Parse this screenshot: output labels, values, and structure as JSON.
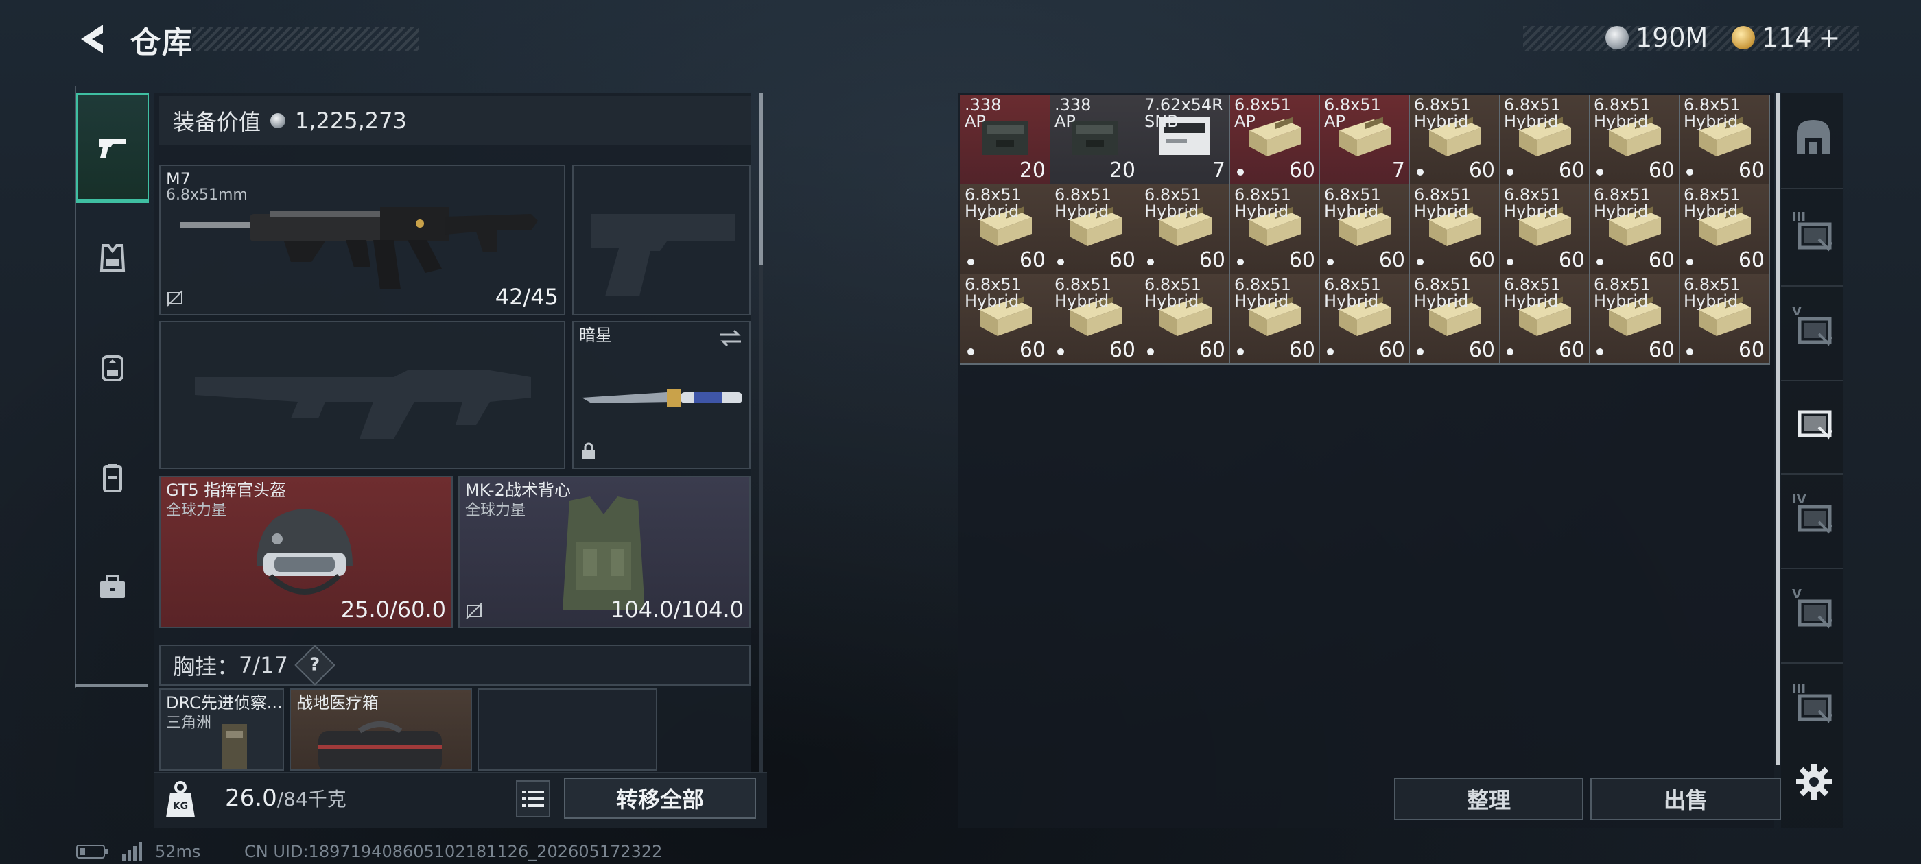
{
  "header": {
    "title": "仓库"
  },
  "currency": {
    "coins_value": "190M",
    "tokens_value": "114",
    "tokens_plus": "+"
  },
  "loadout": {
    "value_label": "装备价值",
    "value": "1,225,273",
    "primary": {
      "name": "M7",
      "caliber": "6.8x51mm",
      "ammo": "42/45"
    },
    "melee": {
      "name": "暗星"
    },
    "helmet": {
      "name": "GT5 指挥官头盔",
      "faction": "全球力量",
      "durability": "25.0/60.0"
    },
    "armor": {
      "name": "MK-2战术背心",
      "faction": "全球力量",
      "durability": "104.0/104.0"
    },
    "rig": {
      "label": "胸挂：",
      "capacity": "7/17",
      "help": "?"
    },
    "rig_items": [
      {
        "name": "DRC先进侦察...",
        "faction": "三角洲"
      },
      {
        "name": "战地医疗箱"
      }
    ],
    "weight_value": "26.0",
    "weight_max": "/84千克",
    "weight_badge": "KG",
    "transfer_all": "转移全部"
  },
  "stash": {
    "items": [
      {
        "l1": ".338",
        "l2": "AP",
        "qty": "20",
        "dot": false,
        "bg": "red",
        "pack": "case"
      },
      {
        "l1": ".338",
        "l2": "AP",
        "qty": "20",
        "dot": false,
        "bg": "dark",
        "pack": "case"
      },
      {
        "l1": "7.62x54R",
        "l2": "SNB",
        "qty": "7",
        "dot": false,
        "bg": "dark",
        "pack": "white"
      },
      {
        "l1": "6.8x51",
        "l2": "AP",
        "qty": "60",
        "dot": true,
        "bg": "red",
        "pack": "box"
      },
      {
        "l1": "6.8x51",
        "l2": "AP",
        "qty": "7",
        "dot": false,
        "bg": "red",
        "pack": "box"
      },
      {
        "l1": "6.8x51",
        "l2": "Hybrid",
        "qty": "60",
        "dot": true,
        "bg": "brown",
        "pack": "box"
      },
      {
        "l1": "6.8x51",
        "l2": "Hybrid",
        "qty": "60",
        "dot": true,
        "bg": "brown",
        "pack": "box"
      },
      {
        "l1": "6.8x51",
        "l2": "Hybrid",
        "qty": "60",
        "dot": true,
        "bg": "brown",
        "pack": "box"
      },
      {
        "l1": "6.8x51",
        "l2": "Hybrid",
        "qty": "60",
        "dot": true,
        "bg": "brown",
        "pack": "box"
      },
      {
        "l1": "6.8x51",
        "l2": "Hybrid",
        "qty": "60",
        "dot": true,
        "bg": "brown",
        "pack": "box"
      },
      {
        "l1": "6.8x51",
        "l2": "Hybrid",
        "qty": "60",
        "dot": true,
        "bg": "brown",
        "pack": "box"
      },
      {
        "l1": "6.8x51",
        "l2": "Hybrid",
        "qty": "60",
        "dot": true,
        "bg": "brown",
        "pack": "box"
      },
      {
        "l1": "6.8x51",
        "l2": "Hybrid",
        "qty": "60",
        "dot": true,
        "bg": "brown",
        "pack": "box"
      },
      {
        "l1": "6.8x51",
        "l2": "Hybrid",
        "qty": "60",
        "dot": true,
        "bg": "brown",
        "pack": "box"
      },
      {
        "l1": "6.8x51",
        "l2": "Hybrid",
        "qty": "60",
        "dot": true,
        "bg": "brown",
        "pack": "box"
      },
      {
        "l1": "6.8x51",
        "l2": "Hybrid",
        "qty": "60",
        "dot": true,
        "bg": "brown",
        "pack": "box"
      },
      {
        "l1": "6.8x51",
        "l2": "Hybrid",
        "qty": "60",
        "dot": true,
        "bg": "brown",
        "pack": "box"
      },
      {
        "l1": "6.8x51",
        "l2": "Hybrid",
        "qty": "60",
        "dot": true,
        "bg": "brown",
        "pack": "box"
      },
      {
        "l1": "6.8x51",
        "l2": "Hybrid",
        "qty": "60",
        "dot": true,
        "bg": "brown",
        "pack": "box"
      },
      {
        "l1": "6.8x51",
        "l2": "Hybrid",
        "qty": "60",
        "dot": true,
        "bg": "brown",
        "pack": "box"
      },
      {
        "l1": "6.8x51",
        "l2": "Hybrid",
        "qty": "60",
        "dot": true,
        "bg": "brown",
        "pack": "box"
      },
      {
        "l1": "6.8x51",
        "l2": "Hybrid",
        "qty": "60",
        "dot": true,
        "bg": "brown",
        "pack": "box"
      },
      {
        "l1": "6.8x51",
        "l2": "Hybrid",
        "qty": "60",
        "dot": true,
        "bg": "brown",
        "pack": "box"
      },
      {
        "l1": "6.8x51",
        "l2": "Hybrid",
        "qty": "60",
        "dot": true,
        "bg": "brown",
        "pack": "box"
      },
      {
        "l1": "6.8x51",
        "l2": "Hybrid",
        "qty": "60",
        "dot": true,
        "bg": "brown",
        "pack": "box"
      },
      {
        "l1": "6.8x51",
        "l2": "Hybrid",
        "qty": "60",
        "dot": true,
        "bg": "brown",
        "pack": "box"
      },
      {
        "l1": "6.8x51",
        "l2": "Hybrid",
        "qty": "60",
        "dot": true,
        "bg": "brown",
        "pack": "box"
      }
    ],
    "sort_label": "整理",
    "sell_label": "出售",
    "right_tabs": [
      {
        "icon": "safe-box-icon",
        "tier": ""
      },
      {
        "icon": "stash-tier-icon",
        "tier": "III"
      },
      {
        "icon": "stash-tier-icon",
        "tier": "V"
      },
      {
        "icon": "stash-tier-icon",
        "tier": ""
      },
      {
        "icon": "stash-tier-icon",
        "tier": "IV"
      },
      {
        "icon": "stash-tier-icon",
        "tier": "V"
      },
      {
        "icon": "stash-tier-icon",
        "tier": "III"
      }
    ]
  },
  "status": {
    "ping": "52ms",
    "uid": "CN UID:1897194086051021811​26_202605172322"
  },
  "colors": {
    "accent": "#3fbfa2",
    "red_slot": "#6a2c30",
    "ammo_brown": "#4a3d35",
    "armor_slot": "#3b3c4e"
  }
}
